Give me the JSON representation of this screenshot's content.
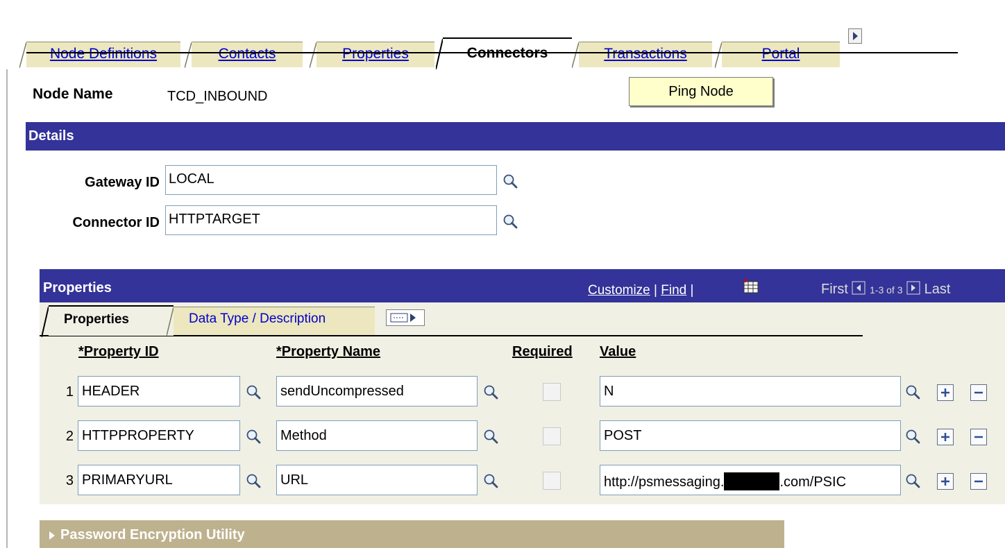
{
  "tabs": [
    {
      "label": "Node Definitions",
      "active": false
    },
    {
      "label": "Contacts",
      "active": false
    },
    {
      "label": "Properties",
      "active": false
    },
    {
      "label": "Connectors",
      "active": true
    },
    {
      "label": "Transactions",
      "active": false
    },
    {
      "label": "Portal",
      "active": false
    }
  ],
  "node": {
    "label": "Node Name",
    "value": "TCD_INBOUND"
  },
  "ping_button": "Ping Node",
  "details": {
    "title": "Details",
    "gateway": {
      "label": "Gateway ID",
      "value": "LOCAL"
    },
    "connector": {
      "label": "Connector ID",
      "value": "HTTPTARGET"
    }
  },
  "grid": {
    "title": "Properties",
    "customize": "Customize",
    "sep": "|",
    "find": "Find",
    "first": "First",
    "range": "1-3 of 3",
    "last": "Last",
    "subtabs": [
      "Properties",
      "Data Type / Description"
    ],
    "columns": [
      "*Property ID",
      "*Property Name",
      "Required",
      "Value"
    ],
    "rows": [
      {
        "num": "1",
        "id": "HEADER",
        "name": "sendUncompressed",
        "required": false,
        "value": "N"
      },
      {
        "num": "2",
        "id": "HTTPPROPERTY",
        "name": "Method",
        "required": false,
        "value": "POST"
      },
      {
        "num": "3",
        "id": "PRIMARYURL",
        "name": "URL",
        "required": false,
        "value_prefix": "http://psmessaging.",
        "value_suffix": ".com/PSIC"
      }
    ]
  },
  "password_section": "Password Encryption Utility",
  "icons": {
    "lookup": "magnifier-icon",
    "add": "plus-icon",
    "delete": "minus-icon",
    "next": "arrow-right-icon",
    "prev": "arrow-left-icon",
    "grid": "grid-icon",
    "expand": "triangle-right-icon"
  },
  "colors": {
    "header_bar": "#333399",
    "tab_bg": "#ece7be",
    "button_bg": "#ffffcc",
    "section_bg": "#beb18e",
    "link": "#0000cc"
  }
}
